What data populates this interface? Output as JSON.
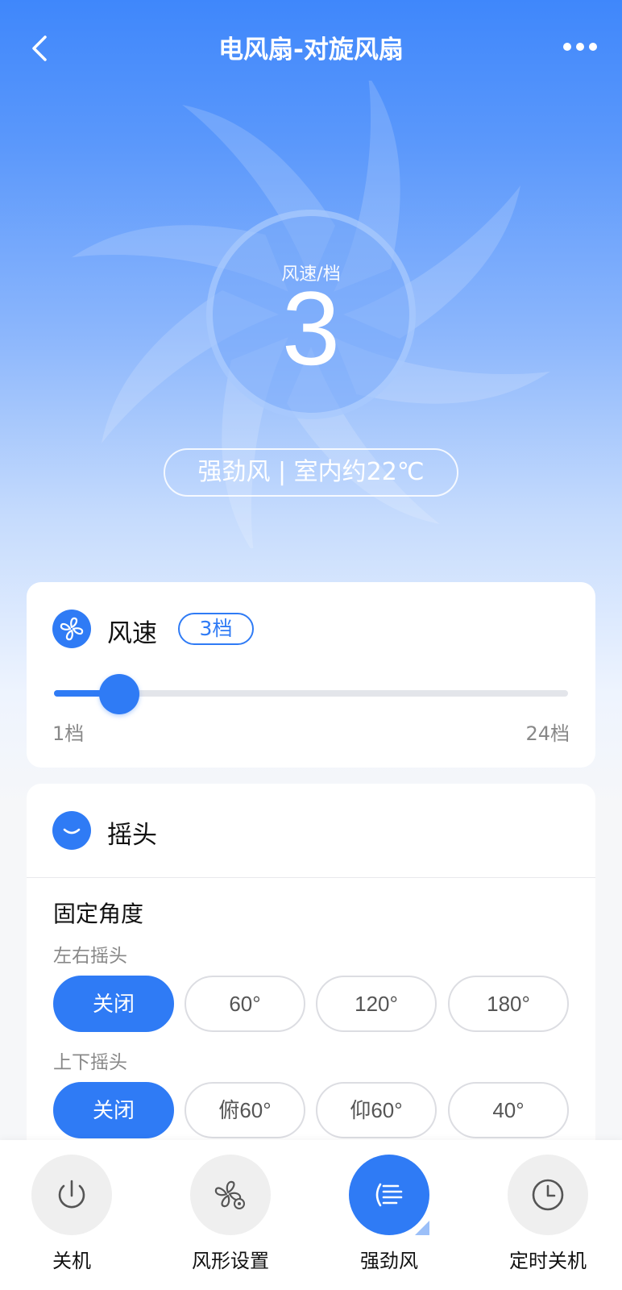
{
  "header": {
    "title": "电风扇-对旋风扇"
  },
  "hero": {
    "label": "风速/档",
    "speed_value": "3",
    "status": "强劲风 | 室内约22℃"
  },
  "speed_card": {
    "title": "风速",
    "badge": "3档",
    "min_label": "1档",
    "max_label": "24档",
    "slider": {
      "min": 1,
      "max": 24,
      "value": 3
    }
  },
  "swing_card": {
    "title": "摇头",
    "section_title": "固定角度",
    "horizontal": {
      "label": "左右摇头",
      "options": [
        "关闭",
        "60°",
        "120°",
        "180°"
      ],
      "selected": 0
    },
    "vertical": {
      "label": "上下摇头",
      "options": [
        "关闭",
        "俯60°",
        "仰60°",
        "40°"
      ],
      "selected": 0
    }
  },
  "bottom_bar": {
    "tabs": [
      {
        "label": "关机",
        "icon": "power-icon",
        "active": false
      },
      {
        "label": "风形设置",
        "icon": "fan-settings-icon",
        "active": false
      },
      {
        "label": "强劲风",
        "icon": "strong-wind-icon",
        "active": true
      },
      {
        "label": "定时关机",
        "icon": "clock-icon",
        "active": false
      }
    ]
  },
  "colors": {
    "accent": "#2f7bf5",
    "header_gradient_top": "#3f87fb",
    "page_background": "#f6f7f9"
  }
}
